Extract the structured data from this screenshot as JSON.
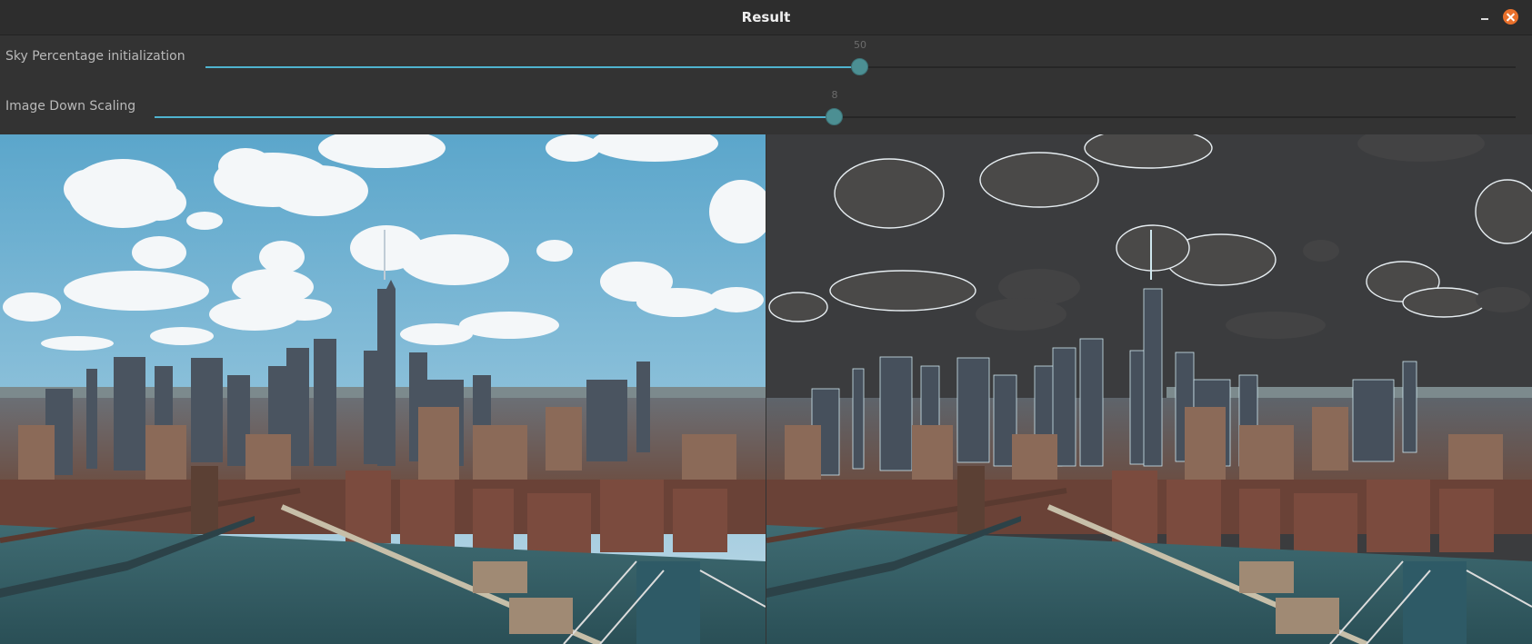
{
  "window": {
    "title": "Result",
    "minimize_icon": "minimize-icon",
    "close_icon": "close-icon",
    "close_color": "#e9702b"
  },
  "trackbars": [
    {
      "label": "Sky Percentage initialization",
      "value": "50",
      "fill_fraction": 0.5
    },
    {
      "label": "Image Down Scaling",
      "value": "8",
      "fill_fraction": 0.5
    }
  ],
  "accent_color": "#4fb3cf",
  "images": {
    "left": "original-city-skyline-photo",
    "right": "sky-segmented-city-skyline-photo"
  }
}
